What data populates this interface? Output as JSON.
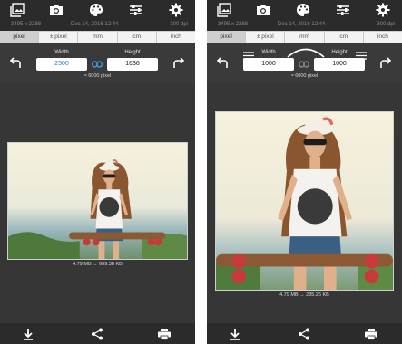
{
  "screens": [
    {
      "toolbar": {
        "icons": [
          "gallery-icon",
          "camera-icon",
          "palette-icon",
          "sliders-icon",
          "gear-icon"
        ]
      },
      "info": {
        "dimensions": "3495 x 2288",
        "date": "Dec 14, 2016 12:44",
        "dpi": "300 dpi"
      },
      "units": {
        "tabs": [
          "pixel",
          "± pixel",
          "mm",
          "cm",
          "inch"
        ],
        "active": "pixel"
      },
      "resize": {
        "width_label": "Width",
        "height_label": "Height",
        "width_value": "2500",
        "height_value": "1636",
        "pixel_total": "≈ 6000 pixel"
      },
      "file_size": "4.79 MB → 609.38 KB",
      "bottom": {
        "icons": [
          "download-icon",
          "share-icon",
          "print-icon"
        ]
      }
    },
    {
      "toolbar": {
        "icons": [
          "gallery-icon",
          "camera-icon",
          "palette-icon",
          "sliders-icon",
          "gear-icon"
        ]
      },
      "info": {
        "dimensions": "3495 x 2288",
        "date": "Dec 14, 2016 12:44",
        "dpi": "300 dpi"
      },
      "units": {
        "tabs": [
          "pixel",
          "± pixel",
          "mm",
          "cm",
          "inch"
        ],
        "active": "pixel"
      },
      "resize": {
        "width_label": "Width",
        "height_label": "Height",
        "width_value": "1000",
        "height_value": "1000",
        "pixel_total": "≈ 6000 pixel"
      },
      "file_size": "4.79 MB → 235.26 KB",
      "bottom": {
        "icons": [
          "download-icon",
          "share-icon",
          "print-icon"
        ]
      }
    }
  ],
  "colors": {
    "background": "#363636",
    "bar": "#2b2b2b",
    "tab_strip": "#f3f3f3",
    "tab_active": "#cfcfcf",
    "accent_blue": "#1e7fd0",
    "icon": "#ffffff"
  }
}
